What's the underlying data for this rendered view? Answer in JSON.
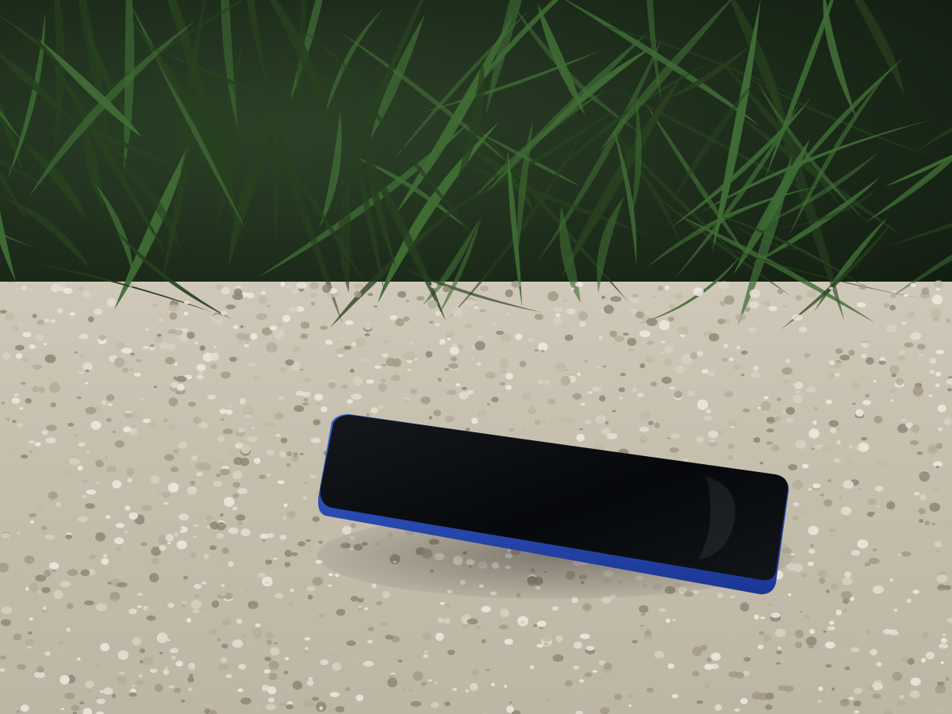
{
  "scene": {
    "foliage_color": "#3f6b35",
    "foliage_dark": "#172416",
    "gravel_base": "#c9c2b1",
    "phone_body": "#2f56c8",
    "phone_edge": "#1c3a9a",
    "phone_screen": "#0b0d10"
  }
}
